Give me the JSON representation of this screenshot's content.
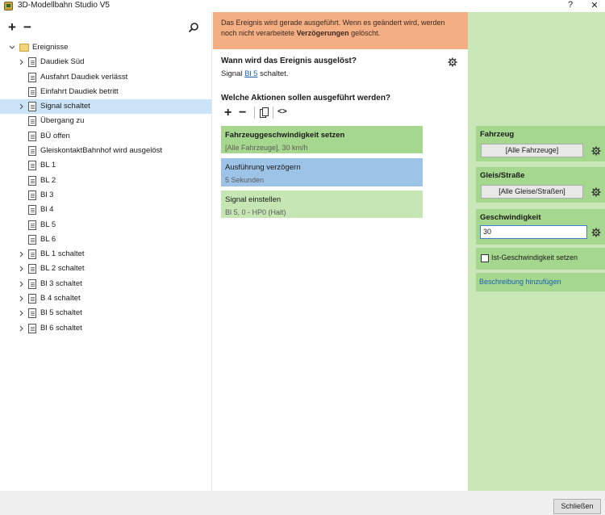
{
  "window": {
    "title": "3D-Modellbahn Studio V5",
    "help_label": "?",
    "close_label": "✕"
  },
  "left_toolbar": {
    "add_label": "+",
    "remove_label": "−"
  },
  "tree": {
    "root_label": "Ereignisse",
    "items": [
      {
        "label": "Daudiek Süd",
        "expandable": true,
        "selected": false
      },
      {
        "label": "Ausfahrt Daudiek verlässt",
        "expandable": false,
        "selected": false
      },
      {
        "label": "Einfahrt Daudiek betritt",
        "expandable": false,
        "selected": false
      },
      {
        "label": "Signal schaltet",
        "expandable": true,
        "selected": true
      },
      {
        "label": "Übergang zu",
        "expandable": false,
        "selected": false
      },
      {
        "label": "BÜ offen",
        "expandable": false,
        "selected": false
      },
      {
        "label": "GleiskontaktBahnhof wird ausgelöst",
        "expandable": false,
        "selected": false
      },
      {
        "label": "BL 1",
        "expandable": false,
        "selected": false
      },
      {
        "label": "BL 2",
        "expandable": false,
        "selected": false
      },
      {
        "label": "Bl  3",
        "expandable": false,
        "selected": false
      },
      {
        "label": "Bl  4",
        "expandable": false,
        "selected": false
      },
      {
        "label": "BL 5",
        "expandable": false,
        "selected": false
      },
      {
        "label": "BL 6",
        "expandable": false,
        "selected": false
      },
      {
        "label": "BL 1 schaltet",
        "expandable": true,
        "selected": false
      },
      {
        "label": "BL 2 schaltet",
        "expandable": true,
        "selected": false
      },
      {
        "label": "Bl  3 schaltet",
        "expandable": true,
        "selected": false
      },
      {
        "label": "B  4  schaltet",
        "expandable": true,
        "selected": false
      },
      {
        "label": "Bl 5 schaltet",
        "expandable": true,
        "selected": false
      },
      {
        "label": "Bl 6 schaltet",
        "expandable": true,
        "selected": false
      }
    ]
  },
  "warning": {
    "line1": "Das Ereignis wird gerade ausgeführt. Wenn es geändert wird, werden",
    "line2_prefix": "noch nicht verarbeitete ",
    "line2_bold": "Verzögerungen",
    "line2_suffix": " gelöscht."
  },
  "trigger": {
    "heading": "Wann wird das Ereignis ausgelöst?",
    "prefix": "Signal ",
    "link": "Bl 5",
    "suffix": " schaltet."
  },
  "actions": {
    "heading": "Welche Aktionen sollen ausgeführt werden?",
    "toolbar": {
      "add": "+",
      "remove": "−",
      "code": "<>"
    },
    "items": [
      {
        "title": "Fahrzeuggeschwindigkeit setzen",
        "subtitle": "[Alle Fahrzeuge], 30 km/h",
        "color": "#a6d78e",
        "bold": true
      },
      {
        "title": "Ausführung verzögern",
        "subtitle": "5 Sekunden",
        "color": "#9dc3e6",
        "bold": false
      },
      {
        "title": "Signal einstellen",
        "subtitle": "Bl 5, 0 - HP0 (Halt)",
        "color": "#c6e6b3",
        "bold": false
      }
    ]
  },
  "properties": {
    "vehicle_label": "Fahrzeug",
    "vehicle_value": "[Alle Fahrzeuge]",
    "track_label": "Gleis/Straße",
    "track_value": "[Alle Gleise/Straßen]",
    "speed_label": "Geschwindigkeit",
    "speed_value": "30",
    "actual_speed_label": "Ist-Geschwindigkeit setzen",
    "add_description_label": "Beschreibung hinzufügen"
  },
  "footer": {
    "close_button": "Schließen"
  },
  "colors": {
    "warning_bg": "#f4ae84",
    "right_panel_bg": "#c9e7b7",
    "prop_block_bg": "#a6d78e",
    "selected_row": "#cce4f7",
    "link": "#1a5fb4"
  }
}
